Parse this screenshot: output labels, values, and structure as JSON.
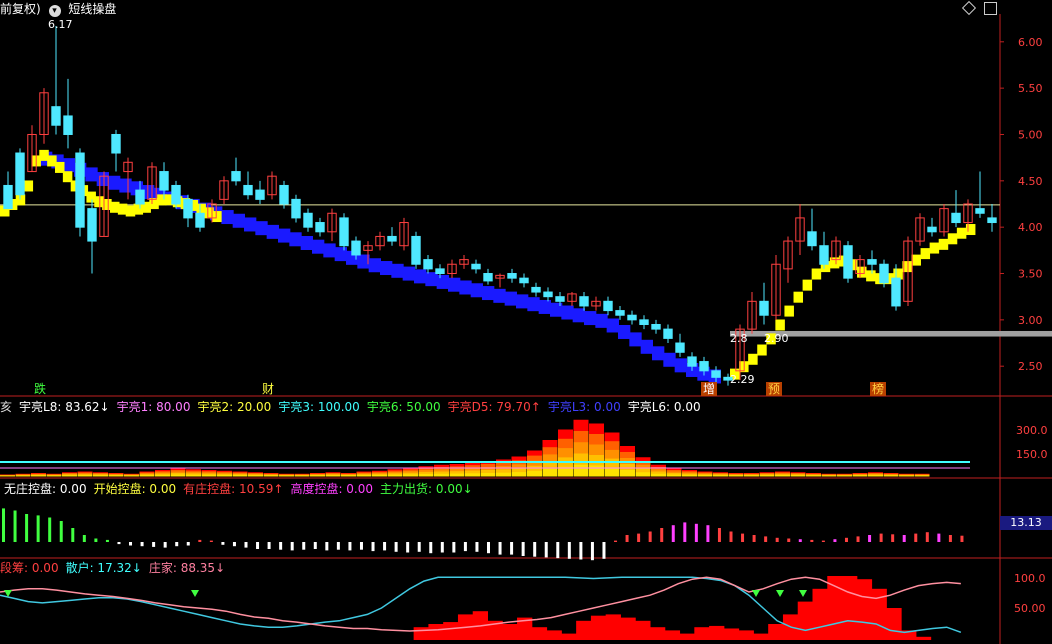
{
  "header": {
    "title_prefix": "前复权)",
    "indicator_name": "短线操盘",
    "menu_icon": "chevron-down-icon",
    "toggle_icon": "diamond-icon",
    "window_icon": "window-icon"
  },
  "colors": {
    "up": "#ff4040",
    "down": "#4fe8ff",
    "band_blue": "#1a1aff",
    "band_yellow": "#ffff00",
    "axis": "#c02020",
    "support": "#a0a0a0",
    "resist": "#e8e8a0"
  },
  "main_panel": {
    "price_labels": {
      "high": "6.17",
      "low": "2.29",
      "mid_left": "2.8",
      "mid_right": "2.90"
    },
    "markers": [
      "跌",
      "财",
      "增",
      "预",
      "榜"
    ],
    "y_ticks": [
      "6.00",
      "5.50",
      "5.00",
      "4.50",
      "4.00",
      "3.50",
      "3.00",
      "2.50"
    ]
  },
  "panel2": {
    "legend": [
      {
        "text": "亥",
        "color": "#dddddd"
      },
      {
        "text": "宇亮L8: 83.62↓",
        "color": "#ffffff"
      },
      {
        "text": "宇亮1: 80.00",
        "color": "#ff80ff"
      },
      {
        "text": "宇亮2: 20.00",
        "color": "#ffff40"
      },
      {
        "text": "宇亮3: 100.00",
        "color": "#40ffff"
      },
      {
        "text": "宇亮6: 50.00",
        "color": "#40ff40"
      },
      {
        "text": "宇亮D5: 79.70↑",
        "color": "#ff4040"
      },
      {
        "text": "宇亮L3: 0.00",
        "color": "#4040ff"
      },
      {
        "text": "宇亮L6: 0.00",
        "color": "#ffffff"
      }
    ],
    "y_ticks": [
      "300.0",
      "150.0"
    ]
  },
  "panel3": {
    "legend": [
      {
        "text": "无庄控盘: 0.00",
        "color": "#ffffff"
      },
      {
        "text": "开始控盘: 0.00",
        "color": "#ffff40"
      },
      {
        "text": "有庄控盘: 10.59↑",
        "color": "#ff4040"
      },
      {
        "text": "高度控盘: 0.00",
        "color": "#ff40ff"
      },
      {
        "text": "主力出货: 0.00↓",
        "color": "#40ff40"
      }
    ],
    "price_tag": "13.13"
  },
  "panel4": {
    "legend": [
      {
        "text": "段筹: 0.00",
        "color": "#ff4040"
      },
      {
        "text": "散户: 17.32↓",
        "color": "#40ffff"
      },
      {
        "text": "庄家: 88.35↓",
        "color": "#ff80a0"
      }
    ],
    "y_ticks": [
      "100.0",
      "50.00"
    ]
  },
  "chart_data": {
    "type": "candlestick",
    "ylim": [
      2.2,
      6.3
    ],
    "resistance_level": 4.24,
    "support_band": [
      2.82,
      2.88
    ],
    "candles": [
      [
        4.45,
        4.6,
        4.2,
        4.2
      ],
      [
        4.8,
        4.85,
        4.3,
        4.35
      ],
      [
        4.6,
        5.1,
        4.6,
        5.0
      ],
      [
        5.0,
        5.5,
        4.9,
        5.45
      ],
      [
        5.3,
        6.17,
        5.0,
        5.1
      ],
      [
        5.2,
        5.6,
        4.85,
        5.0
      ],
      [
        4.8,
        4.85,
        3.9,
        4.0
      ],
      [
        4.2,
        4.3,
        3.5,
        3.85
      ],
      [
        3.9,
        4.6,
        3.9,
        4.55
      ],
      [
        5.0,
        5.05,
        4.6,
        4.8
      ],
      [
        4.6,
        4.75,
        4.3,
        4.7
      ],
      [
        4.4,
        4.5,
        4.2,
        4.25
      ],
      [
        4.3,
        4.7,
        4.25,
        4.65
      ],
      [
        4.6,
        4.7,
        4.3,
        4.4
      ],
      [
        4.45,
        4.5,
        4.2,
        4.25
      ],
      [
        4.3,
        4.35,
        4.0,
        4.1
      ],
      [
        4.15,
        4.25,
        3.95,
        4.0
      ],
      [
        4.1,
        4.3,
        4.05,
        4.25
      ],
      [
        4.3,
        4.55,
        4.25,
        4.5
      ],
      [
        4.6,
        4.75,
        4.45,
        4.5
      ],
      [
        4.45,
        4.6,
        4.3,
        4.35
      ],
      [
        4.4,
        4.5,
        4.25,
        4.3
      ],
      [
        4.35,
        4.6,
        4.3,
        4.55
      ],
      [
        4.45,
        4.5,
        4.2,
        4.25
      ],
      [
        4.3,
        4.35,
        4.05,
        4.1
      ],
      [
        4.15,
        4.2,
        3.95,
        4.0
      ],
      [
        4.05,
        4.1,
        3.9,
        3.95
      ],
      [
        3.95,
        4.2,
        3.85,
        4.15
      ],
      [
        4.1,
        4.15,
        3.75,
        3.8
      ],
      [
        3.85,
        3.9,
        3.65,
        3.7
      ],
      [
        3.75,
        3.85,
        3.6,
        3.8
      ],
      [
        3.8,
        3.95,
        3.75,
        3.9
      ],
      [
        3.9,
        4.0,
        3.8,
        3.85
      ],
      [
        3.8,
        4.1,
        3.75,
        4.05
      ],
      [
        3.9,
        3.95,
        3.55,
        3.6
      ],
      [
        3.65,
        3.7,
        3.5,
        3.55
      ],
      [
        3.55,
        3.6,
        3.45,
        3.5
      ],
      [
        3.5,
        3.65,
        3.45,
        3.6
      ],
      [
        3.6,
        3.7,
        3.55,
        3.65
      ],
      [
        3.6,
        3.65,
        3.5,
        3.55
      ],
      [
        3.5,
        3.55,
        3.38,
        3.42
      ],
      [
        3.45,
        3.5,
        3.35,
        3.48
      ],
      [
        3.5,
        3.55,
        3.4,
        3.45
      ],
      [
        3.45,
        3.5,
        3.35,
        3.4
      ],
      [
        3.35,
        3.4,
        3.25,
        3.3
      ],
      [
        3.3,
        3.35,
        3.2,
        3.25
      ],
      [
        3.25,
        3.3,
        3.15,
        3.2
      ],
      [
        3.2,
        3.3,
        3.15,
        3.28
      ],
      [
        3.25,
        3.3,
        3.1,
        3.15
      ],
      [
        3.15,
        3.25,
        3.1,
        3.2
      ],
      [
        3.2,
        3.25,
        3.05,
        3.1
      ],
      [
        3.1,
        3.15,
        3.0,
        3.05
      ],
      [
        3.05,
        3.1,
        2.95,
        3.0
      ],
      [
        3.0,
        3.05,
        2.9,
        2.95
      ],
      [
        2.95,
        3.0,
        2.85,
        2.9
      ],
      [
        2.9,
        2.95,
        2.75,
        2.8
      ],
      [
        2.75,
        2.85,
        2.6,
        2.65
      ],
      [
        2.6,
        2.65,
        2.45,
        2.5
      ],
      [
        2.55,
        2.6,
        2.4,
        2.45
      ],
      [
        2.45,
        2.5,
        2.32,
        2.38
      ],
      [
        2.38,
        2.42,
        2.29,
        2.35
      ],
      [
        2.45,
        2.95,
        2.35,
        2.9
      ],
      [
        2.9,
        3.3,
        2.85,
        3.2
      ],
      [
        3.2,
        3.4,
        2.95,
        3.05
      ],
      [
        3.05,
        3.7,
        3.0,
        3.6
      ],
      [
        3.55,
        3.9,
        3.4,
        3.85
      ],
      [
        3.85,
        4.25,
        3.7,
        4.1
      ],
      [
        3.95,
        4.2,
        3.75,
        3.8
      ],
      [
        3.8,
        3.95,
        3.55,
        3.6
      ],
      [
        3.65,
        3.9,
        3.6,
        3.85
      ],
      [
        3.8,
        3.85,
        3.4,
        3.45
      ],
      [
        3.5,
        3.7,
        3.45,
        3.65
      ],
      [
        3.65,
        3.75,
        3.5,
        3.6
      ],
      [
        3.6,
        3.65,
        3.35,
        3.4
      ],
      [
        3.45,
        3.6,
        3.1,
        3.15
      ],
      [
        3.2,
        3.9,
        3.15,
        3.85
      ],
      [
        3.85,
        4.15,
        3.8,
        4.1
      ],
      [
        4.0,
        4.1,
        3.9,
        3.95
      ],
      [
        3.95,
        4.25,
        3.9,
        4.2
      ],
      [
        4.15,
        4.4,
        4.0,
        4.05
      ],
      [
        4.05,
        4.3,
        3.95,
        4.25
      ],
      [
        4.2,
        4.6,
        4.1,
        4.15
      ],
      [
        4.1,
        4.25,
        3.95,
        4.05
      ]
    ],
    "band_blue": [
      4.75,
      4.72,
      4.68,
      4.63,
      4.58,
      4.53,
      4.49,
      4.46,
      4.43,
      4.39,
      4.36,
      4.32,
      4.28,
      4.24,
      4.2,
      4.16,
      4.12,
      4.08,
      4.04,
      4.0,
      3.96,
      3.92,
      3.88,
      3.84,
      3.8,
      3.76,
      3.72,
      3.68,
      3.64,
      3.6,
      3.57,
      3.54,
      3.51,
      3.48,
      3.45,
      3.42,
      3.39,
      3.36,
      3.33,
      3.3,
      3.27,
      3.24,
      3.21,
      3.18,
      3.15,
      3.12,
      3.09,
      3.06,
      3.03,
      3.0,
      2.95,
      2.88,
      2.8,
      2.72,
      2.65,
      2.58,
      2.52,
      2.47,
      2.43,
      2.4
    ],
    "band_yellow": [
      4.18,
      4.25,
      4.3,
      4.45,
      4.72,
      4.78,
      4.72,
      4.65,
      4.55,
      4.45,
      4.4,
      4.33,
      4.28,
      4.25,
      4.22,
      4.2,
      4.18,
      4.2,
      4.22,
      4.26,
      4.3,
      4.3,
      4.28,
      4.26,
      4.24,
      4.2,
      4.16,
      4.12,
      2.42,
      2.5,
      2.58,
      2.68,
      2.8,
      2.95,
      3.1,
      3.25,
      3.38,
      3.5,
      3.58,
      3.62,
      3.64,
      3.6,
      3.52,
      3.48,
      3.45,
      3.45,
      3.5,
      3.58,
      3.65,
      3.72,
      3.78,
      3.82,
      3.88,
      3.94,
      3.98
    ],
    "volume_stack": [
      2,
      3,
      4,
      3,
      5,
      6,
      5,
      4,
      3,
      6,
      8,
      10,
      9,
      8,
      7,
      6,
      5,
      4,
      3,
      3,
      4,
      5,
      4,
      6,
      7,
      9,
      11,
      13,
      15,
      16,
      18,
      20,
      22,
      26,
      34,
      48,
      62,
      75,
      70,
      58,
      40,
      25,
      15,
      10,
      8,
      6,
      5,
      4,
      4,
      5,
      6,
      5,
      4,
      3,
      3,
      4,
      5,
      4,
      3,
      3
    ],
    "control_bars": [
      48,
      45,
      40,
      38,
      35,
      30,
      20,
      10,
      5,
      3,
      -3,
      -5,
      -6,
      -7,
      -8,
      -6,
      -5,
      3,
      2,
      -4,
      -6,
      -8,
      -10,
      -10,
      -11,
      -12,
      -11,
      -10,
      -12,
      -11,
      -12,
      -11,
      -13,
      -12,
      -14,
      -15,
      -14,
      -16,
      -15,
      -15,
      -13,
      -14,
      -16,
      -18,
      -18,
      -20,
      -21,
      -22,
      -23,
      -24,
      -25,
      -26,
      -24,
      2,
      10,
      12,
      15,
      20,
      24,
      28,
      26,
      24,
      20,
      15,
      12,
      10,
      8,
      6,
      5,
      4,
      3,
      2,
      4,
      6,
      8,
      10,
      12,
      11,
      10,
      12,
      14,
      12,
      10,
      9
    ],
    "dealer_area": [
      0,
      0,
      0,
      0,
      0,
      0,
      0,
      0,
      0,
      0,
      0,
      0,
      0,
      0,
      0,
      0,
      0,
      0,
      0,
      0,
      0,
      0,
      0,
      0,
      0,
      0,
      0,
      0,
      20,
      25,
      28,
      40,
      45,
      30,
      25,
      35,
      20,
      15,
      10,
      30,
      38,
      40,
      35,
      30,
      20,
      15,
      10,
      20,
      22,
      18,
      15,
      10,
      25,
      40,
      60,
      80,
      100,
      100,
      95,
      80,
      50,
      15,
      5,
      0,
      0,
      0
    ],
    "retail_line": [
      70,
      65,
      60,
      58,
      60,
      62,
      64,
      66,
      66,
      64,
      60,
      55,
      50,
      45,
      40,
      35,
      30,
      25,
      22,
      20,
      20,
      22,
      25,
      28,
      30,
      35,
      40,
      50,
      65,
      80,
      92,
      98,
      98,
      98,
      98,
      98,
      98,
      98,
      98,
      98,
      98,
      97,
      96,
      97,
      98,
      98,
      98,
      98,
      98,
      98,
      96,
      93,
      85,
      70,
      50,
      30,
      20,
      15,
      20,
      25,
      30,
      28,
      25,
      15,
      12,
      15,
      18,
      20,
      12
    ],
    "dealer_line": [
      75,
      78,
      80,
      80,
      78,
      75,
      72,
      70,
      68,
      65,
      62,
      58,
      55,
      52,
      50,
      48,
      45,
      40,
      36,
      34,
      30,
      28,
      25,
      22,
      20,
      18,
      18,
      16,
      15,
      14,
      15,
      16,
      18,
      20,
      22,
      25,
      28,
      30,
      32,
      35,
      40,
      45,
      50,
      55,
      60,
      65,
      70,
      78,
      88,
      95,
      98,
      95,
      85,
      75,
      80,
      88,
      95,
      98,
      95,
      85,
      75,
      68,
      65,
      70,
      78,
      85,
      88,
      90,
      88
    ]
  }
}
